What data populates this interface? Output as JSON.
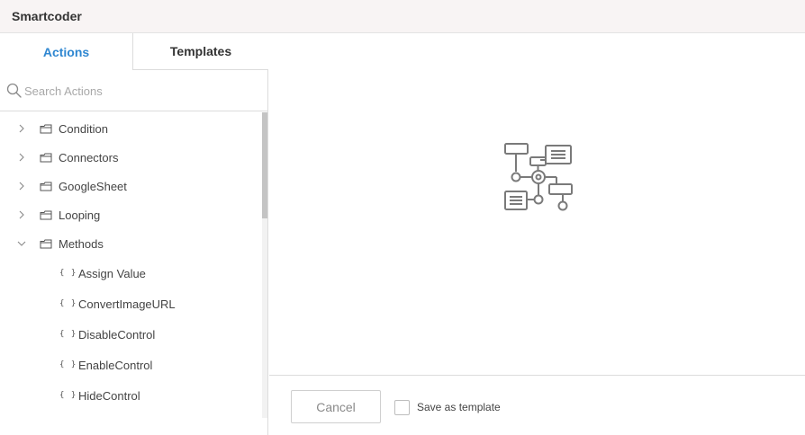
{
  "app": {
    "title": "Smartcoder"
  },
  "tabs": [
    {
      "label": "Actions",
      "active": true
    },
    {
      "label": "Templates",
      "active": false
    }
  ],
  "search": {
    "placeholder": "Search Actions",
    "value": ""
  },
  "tree": {
    "folders": [
      {
        "label": "Condition",
        "expanded": false
      },
      {
        "label": "Connectors",
        "expanded": false
      },
      {
        "label": "GoogleSheet",
        "expanded": false
      },
      {
        "label": "Looping",
        "expanded": false
      },
      {
        "label": "Methods",
        "expanded": true
      }
    ],
    "method_items": [
      {
        "label": "Assign Value"
      },
      {
        "label": "ConvertImageURL"
      },
      {
        "label": "DisableControl"
      },
      {
        "label": "EnableControl"
      },
      {
        "label": "HideControl"
      }
    ],
    "leaf_icon": "{ }"
  },
  "footer": {
    "cancel_label": "Cancel",
    "save_template_label": "Save as template",
    "save_template_checked": false
  },
  "colors": {
    "accent": "#2f87d1",
    "titlebar_bg": "#f8f4f4",
    "border": "#dcdcdc",
    "icon_gray": "#7a7a7a"
  },
  "icons": {
    "search": "search-icon",
    "folder": "folder-icon",
    "chevron_collapsed": "chevron-right-icon",
    "chevron_expanded": "chevron-down-icon",
    "method": "braces-icon",
    "placeholder": "flowchart-icon"
  }
}
